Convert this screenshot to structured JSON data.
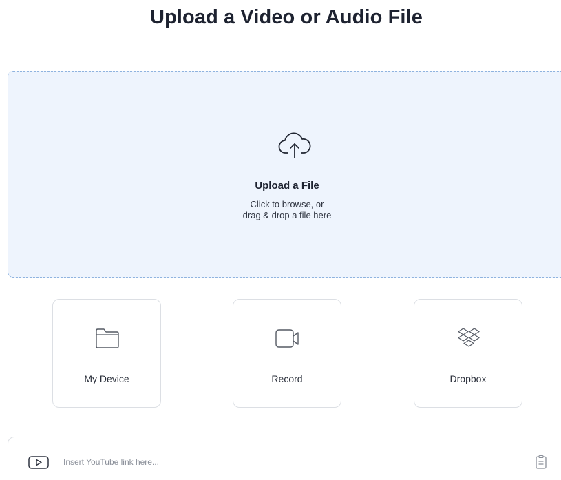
{
  "header": {
    "title": "Upload a Video or Audio File"
  },
  "dropzone": {
    "icon": "cloud-upload-icon",
    "title": "Upload a File",
    "subtitle_line1": "Click to browse, or",
    "subtitle_line2": "drag & drop a file here"
  },
  "sources": [
    {
      "label": "My Device",
      "icon": "folder-icon"
    },
    {
      "label": "Record",
      "icon": "video-camera-icon"
    },
    {
      "label": "Dropbox",
      "icon": "dropbox-icon"
    }
  ],
  "link_bar": {
    "icon": "play-icon",
    "placeholder": "Insert YouTube link here...",
    "value": "",
    "action_icon": "paste-icon"
  },
  "colors": {
    "dropzone_background": "#eef4fd",
    "dropzone_border": "#8fb3df",
    "card_border": "#dcdfe4",
    "text": "#1d2230"
  }
}
